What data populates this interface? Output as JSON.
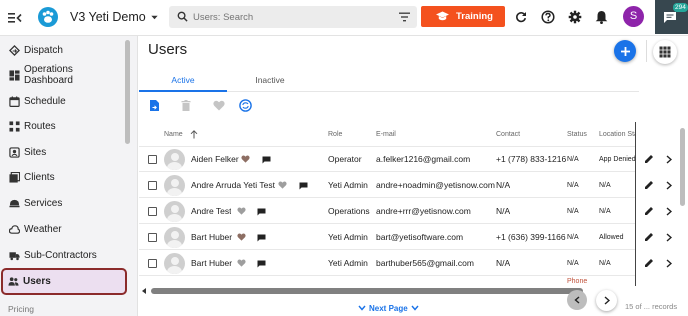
{
  "header": {
    "app_title": "V3 Yeti Demo",
    "search_placeholder": "Users: Search",
    "training_label": "Training",
    "avatar_letter": "S",
    "chat_badge": "294"
  },
  "sidebar": {
    "items": [
      {
        "label": "Dispatch",
        "icon": "dispatch-icon"
      },
      {
        "label": "Operations Dashboard",
        "icon": "dashboard-icon"
      },
      {
        "label": "Schedule",
        "icon": "calendar-icon"
      },
      {
        "label": "Routes",
        "icon": "routes-icon"
      },
      {
        "label": "Sites",
        "icon": "map-pin-icon"
      },
      {
        "label": "Clients",
        "icon": "clients-icon"
      },
      {
        "label": "Services",
        "icon": "services-icon"
      },
      {
        "label": "Weather",
        "icon": "cloud-icon"
      },
      {
        "label": "Sub-Contractors",
        "icon": "truck-icon"
      },
      {
        "label": "Users",
        "icon": "users-icon",
        "active": true
      }
    ],
    "partial_label": "Pricing"
  },
  "main": {
    "page_title": "Users",
    "tabs": [
      {
        "label": "Active",
        "active": true
      },
      {
        "label": "Inactive",
        "active": false
      }
    ],
    "columns": [
      "Name",
      "Role",
      "E-mail",
      "Contact",
      "Status",
      "Location Sta"
    ],
    "rows": [
      {
        "name": "Aiden Felker",
        "role": "Operator",
        "email": "a.felker1216@gmail.com",
        "contact": "+1 (778) 833-1216",
        "status": "N/A",
        "location": "App Denied",
        "favorite": true
      },
      {
        "name": "Andre Arruda Yeti Test",
        "role": "Yeti Admin",
        "email": "andre+noadmin@yetisnow.com",
        "contact": "N/A",
        "status": "N/A",
        "location": "N/A",
        "favorite": false
      },
      {
        "name": "Andre Test",
        "role": "Operations",
        "email": "andre+rrr@yetisnow.com",
        "contact": "N/A",
        "status": "N/A",
        "location": "N/A",
        "favorite": false
      },
      {
        "name": "Bart Huber",
        "role": "Yeti Admin",
        "email": "bart@yetisoftware.com",
        "contact": "+1 (636) 399-1166",
        "status": "N/A",
        "location": "Allowed",
        "favorite": true
      },
      {
        "name": "Bart Huber",
        "role": "Yeti Admin",
        "email": "barthuber565@gmail.com",
        "contact": "N/A",
        "status": "N/A",
        "location": "N/A",
        "favorite": false
      }
    ],
    "partial_row_label": "Phone",
    "next_page_label": "Next Page",
    "footer_count": "15 of ... records"
  },
  "colors": {
    "accent_blue": "#1a73e8",
    "training_orange": "#f4511e",
    "avatar_purple": "#8e24aa",
    "chat_bg": "#37474f",
    "favorite_brown": "#8d6e63",
    "active_highlight": "#ecdff0",
    "active_border": "#8b2b2b"
  }
}
